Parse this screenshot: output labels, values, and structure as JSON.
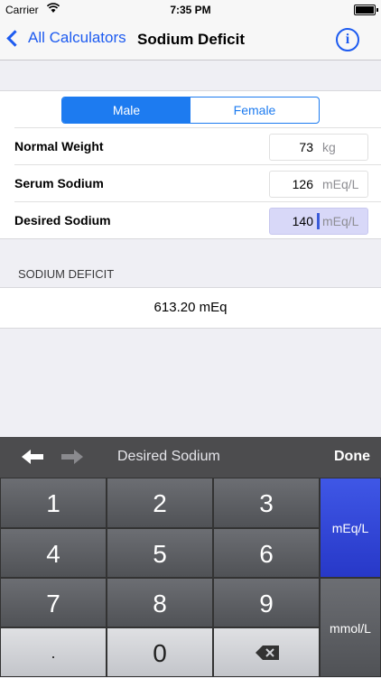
{
  "status": {
    "carrier": "Carrier",
    "time": "7:35 PM"
  },
  "nav": {
    "back_label": "All Calculators",
    "title": "Sodium Deficit",
    "info_glyph": "i"
  },
  "form": {
    "segments": {
      "male": "Male",
      "female": "Female",
      "selected": "Male"
    },
    "rows": [
      {
        "label": "Normal Weight",
        "value": "73",
        "unit": "kg"
      },
      {
        "label": "Serum Sodium",
        "value": "126",
        "unit": "mEq/L"
      },
      {
        "label": "Desired Sodium",
        "value": "140",
        "unit": "mEq/L"
      }
    ]
  },
  "result": {
    "header": "SODIUM DEFICIT",
    "value": "613.20 mEq"
  },
  "keyboard": {
    "field_name": "Desired Sodium",
    "done_label": "Done",
    "keys": [
      "1",
      "2",
      "3",
      "4",
      "5",
      "6",
      "7",
      "8",
      "9",
      ".",
      "0"
    ],
    "units": [
      "mEq/L",
      "mmol/L"
    ],
    "selected_unit": "mEq/L",
    "accent_color": "#2f47d8"
  }
}
